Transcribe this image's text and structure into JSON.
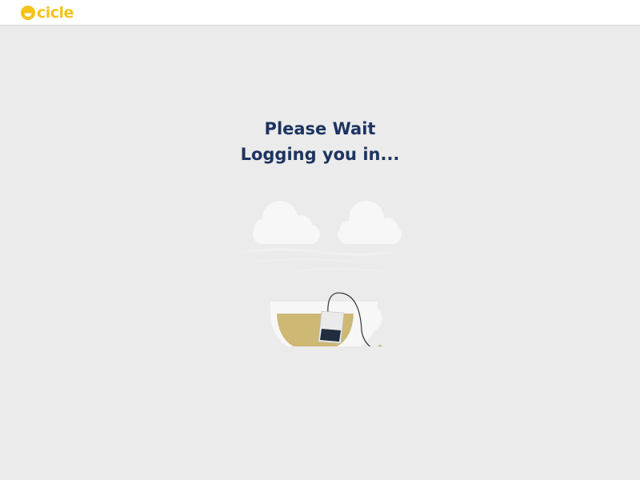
{
  "header": {
    "logo_text": "cicle",
    "brand_color": "#f5c21b"
  },
  "main": {
    "title_line1": "Please Wait",
    "title_line2": "Logging you in...",
    "text_color": "#1d3461",
    "illustration": {
      "icon": "tea-cup-icon",
      "tea_color": "#cdb874",
      "tag_color": "#8bc34a"
    }
  }
}
